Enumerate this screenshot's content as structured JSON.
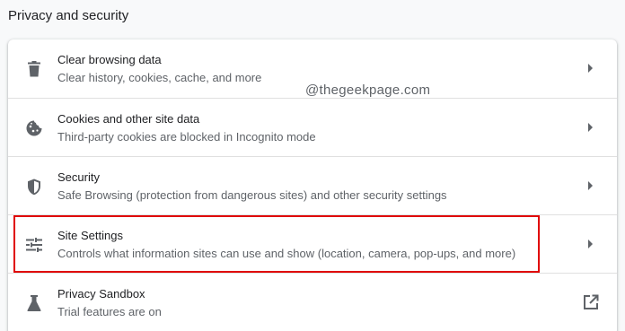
{
  "section": {
    "title": "Privacy and security"
  },
  "watermark": "@thegeekpage.com",
  "rows": [
    {
      "label": "Clear browsing data",
      "sub": "Clear history, cookies, cache, and more",
      "icon": "trash-icon"
    },
    {
      "label": "Cookies and other site data",
      "sub": "Third-party cookies are blocked in Incognito mode",
      "icon": "cookie-icon"
    },
    {
      "label": "Security",
      "sub": "Safe Browsing (protection from dangerous sites) and other security settings",
      "icon": "shield-icon"
    },
    {
      "label": "Site Settings",
      "sub": "Controls what information sites can use and show (location, camera, pop-ups, and more)",
      "icon": "sliders-icon"
    },
    {
      "label": "Privacy Sandbox",
      "sub": "Trial features are on",
      "icon": "flask-icon"
    }
  ],
  "colors": {
    "highlight": "#e00000",
    "icon": "#5f6368",
    "text": "#202124",
    "secondary": "#5f6368"
  }
}
